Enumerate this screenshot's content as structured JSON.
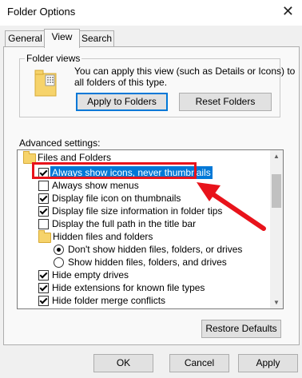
{
  "window": {
    "title": "Folder Options"
  },
  "tabs": [
    {
      "label": "General",
      "active": false
    },
    {
      "label": "View",
      "active": true
    },
    {
      "label": "Search",
      "active": false
    }
  ],
  "folder_views": {
    "legend": "Folder views",
    "description_line1": "You can apply this view (such as Details or Icons) to",
    "description_line2": "all folders of this type.",
    "apply_button": "Apply to Folders",
    "reset_button": "Reset Folders"
  },
  "advanced": {
    "label": "Advanced settings:",
    "items": [
      {
        "type": "folder",
        "label": "Files and Folders",
        "level": 0
      },
      {
        "type": "checkbox",
        "label": "Always show icons, never thumbnails",
        "checked": true,
        "selected": true,
        "level": 1
      },
      {
        "type": "checkbox",
        "label": "Always show menus",
        "checked": false,
        "level": 1
      },
      {
        "type": "checkbox",
        "label": "Display file icon on thumbnails",
        "checked": true,
        "level": 1
      },
      {
        "type": "checkbox",
        "label": "Display file size information in folder tips",
        "checked": true,
        "level": 1
      },
      {
        "type": "checkbox",
        "label": "Display the full path in the title bar",
        "checked": false,
        "level": 1
      },
      {
        "type": "folder",
        "label": "Hidden files and folders",
        "level": 1
      },
      {
        "type": "radio",
        "label": "Don't show hidden files, folders, or drives",
        "checked": true,
        "level": 2
      },
      {
        "type": "radio",
        "label": "Show hidden files, folders, and drives",
        "checked": false,
        "level": 2
      },
      {
        "type": "checkbox",
        "label": "Hide empty drives",
        "checked": true,
        "level": 1
      },
      {
        "type": "checkbox",
        "label": "Hide extensions for known file types",
        "checked": true,
        "level": 1
      },
      {
        "type": "checkbox",
        "label": "Hide folder merge conflicts",
        "checked": true,
        "level": 1
      }
    ],
    "restore_button": "Restore Defaults"
  },
  "footer": {
    "ok": "OK",
    "cancel": "Cancel",
    "apply": "Apply"
  },
  "annotation": {
    "highlight_color": "#e8131b",
    "arrow_color": "#e8131b"
  }
}
